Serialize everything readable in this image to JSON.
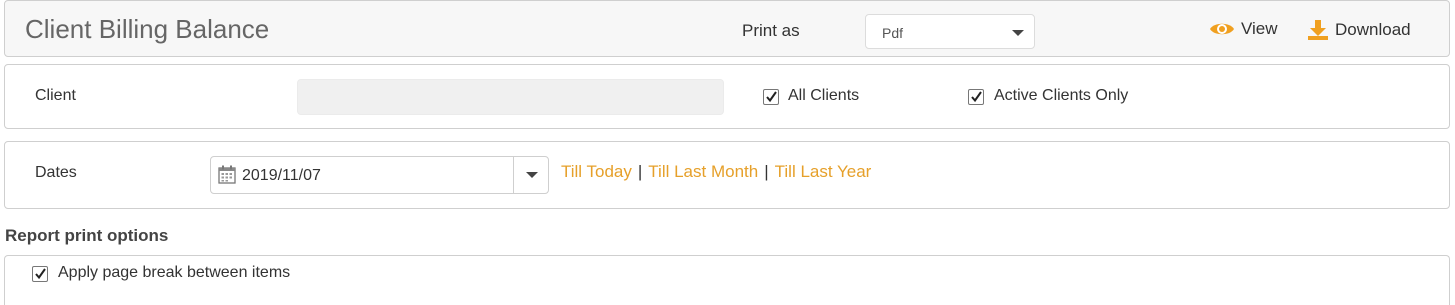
{
  "header": {
    "title": "Client Billing Balance",
    "print_as_label": "Print as",
    "print_format": "Pdf",
    "view_label": "View",
    "download_label": "Download",
    "accent_color": "#f0a020"
  },
  "client": {
    "label": "Client",
    "input_value": "",
    "all_clients_label": "All Clients",
    "all_clients_checked": true,
    "active_only_label": "Active Clients Only",
    "active_only_checked": true
  },
  "dates": {
    "label": "Dates",
    "value": "2019/11/07",
    "shortcuts": [
      "Till Today",
      "Till Last Month",
      "Till Last Year"
    ],
    "separator": "|"
  },
  "report_options": {
    "title": "Report print options",
    "page_break_label": "Apply page break between items",
    "page_break_checked": true
  },
  "icons": [
    "eye-icon",
    "download-icon",
    "calendar-icon",
    "checkmark-icon",
    "chevron-down-icon"
  ]
}
